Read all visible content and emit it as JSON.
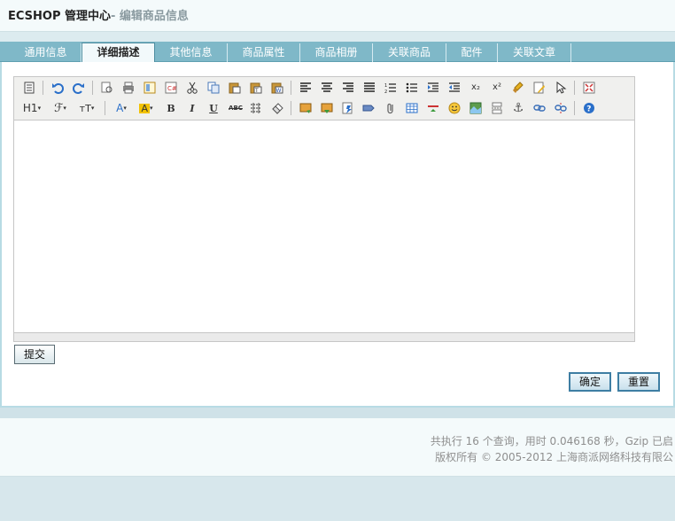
{
  "header": {
    "app_name": "ECSHOP 管理中心",
    "page_sub": "- 编辑商品信息"
  },
  "tabs": [
    {
      "label": "通用信息"
    },
    {
      "label": "详细描述",
      "active": true
    },
    {
      "label": "其他信息"
    },
    {
      "label": "商品属性"
    },
    {
      "label": "商品相册"
    },
    {
      "label": "关联商品"
    },
    {
      "label": "配件"
    },
    {
      "label": "关联文章"
    }
  ],
  "editor": {
    "toolbar_row1": [
      "source-icon",
      "undo-icon",
      "redo-icon",
      "preview-icon",
      "print-icon",
      "template-icon",
      "code-icon",
      "cut-icon",
      "copy-icon",
      "paste-icon",
      "paste-plain-icon",
      "paste-word-icon",
      "align-left-icon",
      "align-center-icon",
      "align-right-icon",
      "justify-icon",
      "ordered-list-icon",
      "unordered-list-icon",
      "indent-icon",
      "outdent-icon",
      "subscript-icon",
      "superscript-icon",
      "clear-format-icon",
      "select-all-icon",
      "select-icon",
      "fullscreen-icon"
    ],
    "toolbar_row2": [
      "heading-icon",
      "font-family-icon",
      "font-size-icon",
      "text-color-icon",
      "highlight-icon",
      "bold-icon",
      "italic-icon",
      "underline-icon",
      "strikethrough-icon",
      "line-height-icon",
      "eraser-icon",
      "image-icon",
      "multi-image-icon",
      "flash-icon",
      "media-icon",
      "attachment-icon",
      "table-icon",
      "hr-icon",
      "emoticon-icon",
      "map-icon",
      "pagebreak-icon",
      "anchor-icon",
      "link-icon",
      "unlink-icon",
      "help-icon"
    ],
    "glyphs": {
      "heading": "H1",
      "font_family": "ℱ",
      "font_size": "тT",
      "text_color": "A",
      "highlight": "A",
      "bold": "B",
      "italic": "I",
      "underline": "U",
      "strike": "ABC",
      "subscript": "x₂",
      "superscript": "x²"
    }
  },
  "buttons": {
    "submit": "提交",
    "confirm": "确定",
    "reset": "重置"
  },
  "footer": {
    "line1": "共执行 16 个查询，用时 0.046168 秒，Gzip 已启",
    "line2": "版权所有 © 2005-2012 上海商派网络科技有限公"
  },
  "colors": {
    "tab_bar": "#7fb8c8",
    "panel_border": "#b7dbe4",
    "background": "#d7e7ec"
  }
}
